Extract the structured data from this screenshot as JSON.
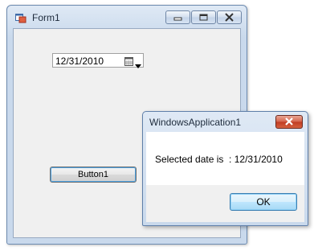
{
  "main_window": {
    "title": "Form1",
    "date_picker": {
      "value": "12/31/2010"
    },
    "button1_label": "Button1"
  },
  "message_box": {
    "title": "WindowsApplication1",
    "message": "Selected date is  : 12/31/2010",
    "ok_label": "OK"
  },
  "icons": {
    "app": "form-icon",
    "minimize": "minimize-icon",
    "maximize": "maximize-icon",
    "close": "close-icon",
    "calendar": "calendar-icon",
    "dropdown": "chevron-down-icon"
  },
  "colors": {
    "close_button": "#c9452c",
    "ok_focus": "#3c7fb1",
    "window_frame": "#c9d9ec"
  }
}
